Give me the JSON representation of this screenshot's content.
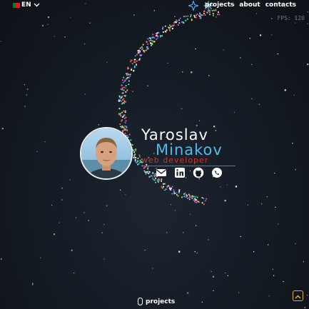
{
  "header": {
    "language": "EN",
    "nav": [
      "projects",
      "about",
      "contacts"
    ]
  },
  "fps": "FPS: 120",
  "profile": {
    "first_name": "Yaroslav",
    "last_name": "Minakov",
    "role": "web developer"
  },
  "footer": {
    "projects_label": "projects"
  },
  "colors": {
    "accent_blue": "#52b9ec",
    "role_red": "#d6302c",
    "scroll_top_border": "#e0b23a",
    "background": "#141a22"
  },
  "icons": [
    "flag-icon",
    "chevron-down-icon",
    "sparkle-icon",
    "snowflake-icon",
    "mail-icon",
    "linkedin-icon",
    "github-icon",
    "whatsapp-icon",
    "mouse-icon",
    "arrow-up-icon"
  ]
}
